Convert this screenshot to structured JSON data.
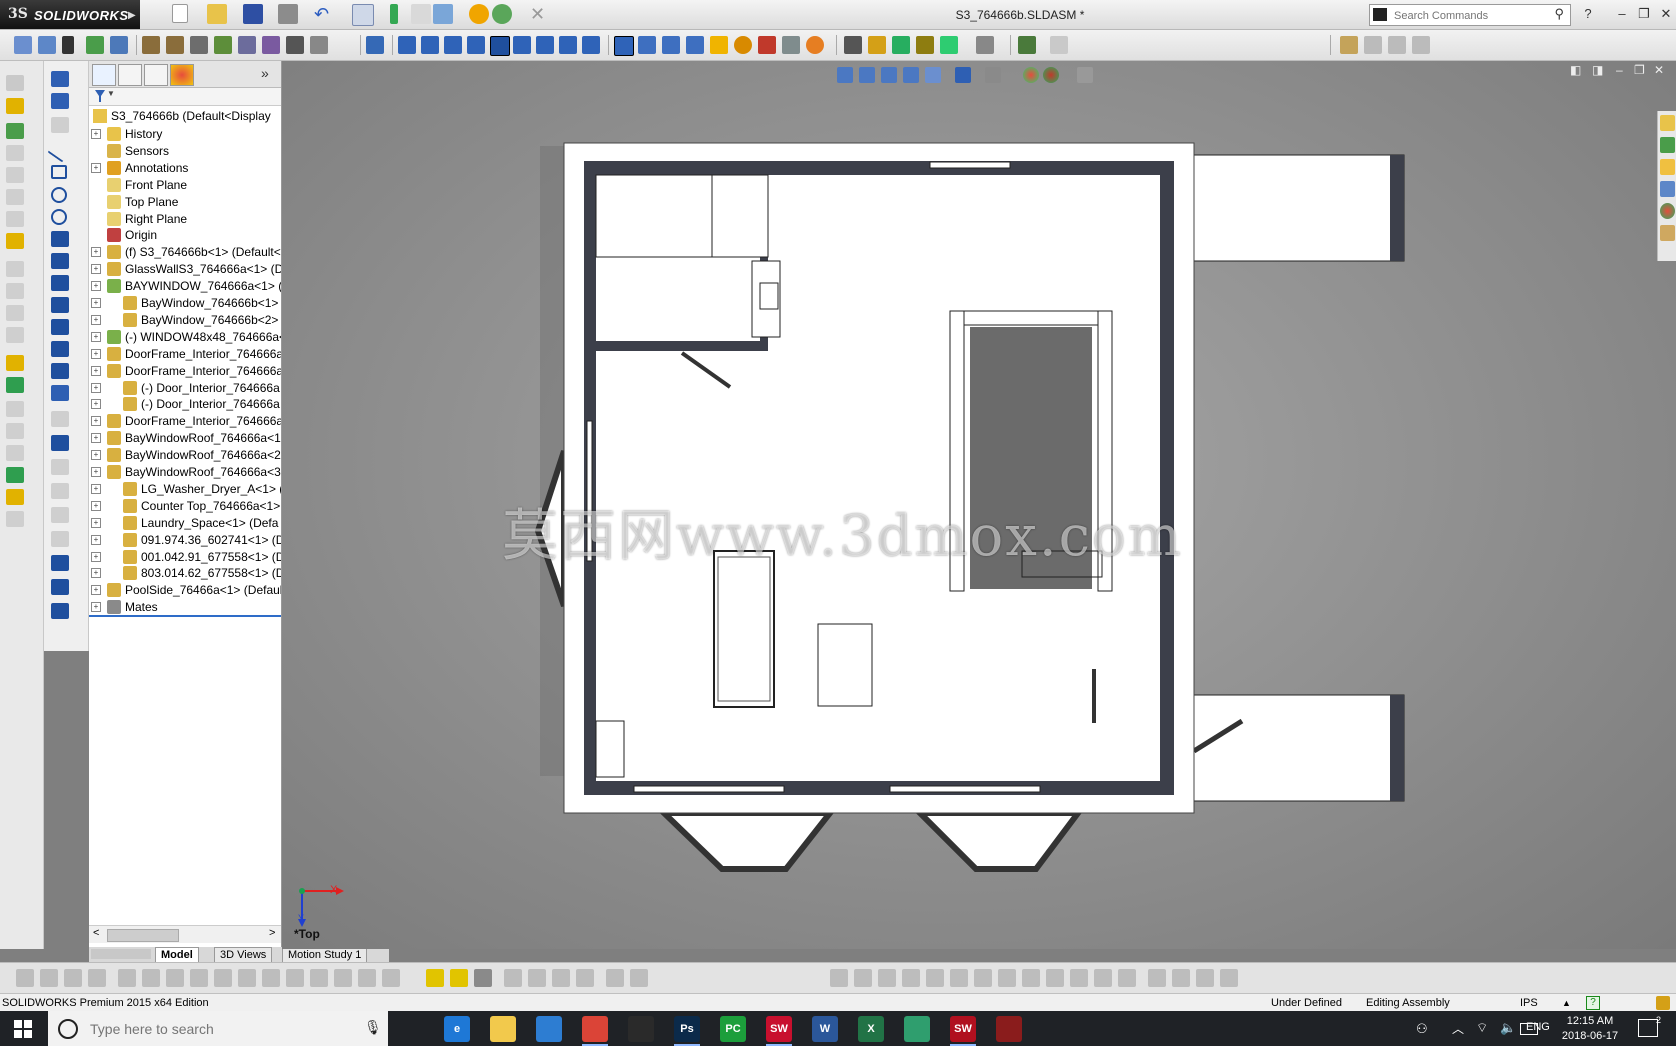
{
  "app": {
    "brand_ds": "3S",
    "brand_name": "SOLIDWORKS",
    "document_title": "S3_764666b.SLDASM *"
  },
  "search": {
    "placeholder": "Search Commands"
  },
  "feature_tree": {
    "root": "S3_764666b  (Default<Display",
    "items": [
      {
        "label": "History",
        "icon": "history-icon",
        "indent": 0,
        "expandable": true
      },
      {
        "label": "Sensors",
        "icon": "sensors-icon",
        "indent": 0,
        "expandable": false
      },
      {
        "label": "Annotations",
        "icon": "annotations-icon",
        "indent": 0,
        "expandable": true
      },
      {
        "label": "Front Plane",
        "icon": "plane-icon",
        "indent": 0,
        "expandable": false
      },
      {
        "label": "Top Plane",
        "icon": "plane-icon",
        "indent": 0,
        "expandable": false
      },
      {
        "label": "Right Plane",
        "icon": "plane-icon",
        "indent": 0,
        "expandable": false
      },
      {
        "label": "Origin",
        "icon": "origin-icon",
        "indent": 0,
        "expandable": false
      },
      {
        "label": "(f) S3_764666b<1> (Default<",
        "icon": "part-icon",
        "indent": 0,
        "expandable": true
      },
      {
        "label": "GlassWallS3_764666a<1> (De",
        "icon": "part-icon",
        "indent": 0,
        "expandable": true
      },
      {
        "label": "BAYWINDOW_764666a<1> (",
        "icon": "assembly-icon",
        "indent": 0,
        "expandable": true
      },
      {
        "label": "BayWindow_764666b<1>",
        "icon": "part-icon",
        "indent": 1,
        "expandable": true
      },
      {
        "label": "BayWindow_764666b<2>",
        "icon": "part-icon",
        "indent": 1,
        "expandable": true
      },
      {
        "label": "(-) WINDOW48x48_764666a<",
        "icon": "assembly-icon",
        "indent": 0,
        "expandable": true
      },
      {
        "label": "DoorFrame_Interior_764666a",
        "icon": "part-icon",
        "indent": 0,
        "expandable": true
      },
      {
        "label": "DoorFrame_Interior_764666a",
        "icon": "part-icon",
        "indent": 0,
        "expandable": true
      },
      {
        "label": "(-) Door_Interior_764666a",
        "icon": "part-icon",
        "indent": 1,
        "expandable": true
      },
      {
        "label": "(-) Door_Interior_764666a",
        "icon": "part-icon",
        "indent": 1,
        "expandable": true
      },
      {
        "label": "DoorFrame_Interior_764666a",
        "icon": "part-icon",
        "indent": 0,
        "expandable": true
      },
      {
        "label": "BayWindowRoof_764666a<1",
        "icon": "part-icon",
        "indent": 0,
        "expandable": true
      },
      {
        "label": "BayWindowRoof_764666a<2",
        "icon": "part-icon",
        "indent": 0,
        "expandable": true
      },
      {
        "label": "BayWindowRoof_764666a<3",
        "icon": "part-icon",
        "indent": 0,
        "expandable": true
      },
      {
        "label": "LG_Washer_Dryer_A<1> (",
        "icon": "part-icon",
        "indent": 1,
        "expandable": true
      },
      {
        "label": "Counter Top_764666a<1>",
        "icon": "part-icon",
        "indent": 1,
        "expandable": true
      },
      {
        "label": "Laundry_Space<1> (Defa",
        "icon": "part-icon",
        "indent": 1,
        "expandable": true
      },
      {
        "label": "091.974.36_602741<1> (D",
        "icon": "part-icon",
        "indent": 1,
        "expandable": true
      },
      {
        "label": "001.042.91_677558<1> (D",
        "icon": "part-icon",
        "indent": 1,
        "expandable": true
      },
      {
        "label": "803.014.62_677558<1> (D",
        "icon": "part-icon",
        "indent": 1,
        "expandable": true
      },
      {
        "label": "PoolSide_76466a<1> (Defaul",
        "icon": "part-icon",
        "indent": 0,
        "expandable": true
      },
      {
        "label": "Mates",
        "icon": "mates-icon",
        "indent": 0,
        "expandable": true
      }
    ]
  },
  "bottom_tabs": [
    "Model",
    "3D Views",
    "Motion Study 1"
  ],
  "viewport": {
    "view_name": "*Top",
    "axis_x": "X",
    "axis_y": "Y",
    "watermark": "莫西网www.3dmox.com"
  },
  "status": {
    "edition": "SOLIDWORKS Premium 2015 x64 Edition",
    "state": "Under Defined",
    "mode": "Editing Assembly",
    "units": "IPS"
  },
  "taskbar": {
    "search_placeholder": "Type here to search",
    "language": "ENG",
    "time": "12:15 AM",
    "date": "2018-06-17",
    "notifications": "2",
    "apps": [
      {
        "name": "task-view",
        "label": "",
        "color": "#1f2226"
      },
      {
        "name": "edge",
        "label": "e",
        "color": "#1e78d6"
      },
      {
        "name": "file-explorer",
        "label": "",
        "color": "#f2c94c"
      },
      {
        "name": "store",
        "label": "",
        "color": "#2d7dd2"
      },
      {
        "name": "chrome",
        "label": "",
        "color": "#db4437"
      },
      {
        "name": "mail",
        "label": "",
        "color": "#2a2a2a"
      },
      {
        "name": "photoshop",
        "label": "Ps",
        "color": "#0b2a4a"
      },
      {
        "name": "pycharm",
        "label": "PC",
        "color": "#1c9e3b"
      },
      {
        "name": "solidworks-2015-a",
        "label": "SW",
        "color": "#c8102e"
      },
      {
        "name": "word",
        "label": "W",
        "color": "#2b579a"
      },
      {
        "name": "excel",
        "label": "X",
        "color": "#217346"
      },
      {
        "name": "globe-app",
        "label": "",
        "color": "#2f9e6e"
      },
      {
        "name": "solidworks-2015-b",
        "label": "SW",
        "color": "#b0101f"
      },
      {
        "name": "swx-app",
        "label": "",
        "color": "#8a1c1c"
      }
    ]
  },
  "colors": {
    "accent": "#c8102e",
    "wall": "#3c3f4a",
    "floor": "#ffffff"
  }
}
